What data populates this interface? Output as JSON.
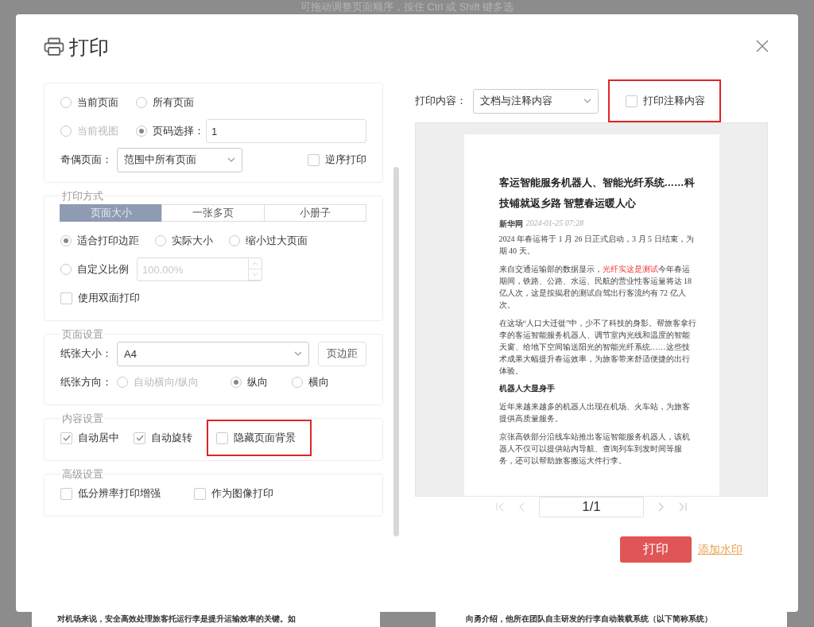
{
  "background_hint": "可拖动调整页面顺序，按住 Ctrl 或 Shift 键多选",
  "dialog": {
    "title": "打印",
    "page_range": {
      "options": [
        {
          "label": "当前页面",
          "selected": false,
          "disabled": false
        },
        {
          "label": "所有页面",
          "selected": false,
          "disabled": false
        },
        {
          "label": "当前视图",
          "selected": false,
          "disabled": true
        },
        {
          "label": "页码选择：",
          "selected": true,
          "disabled": false
        }
      ],
      "page_input": {
        "value": "1"
      },
      "odd_even": {
        "label": "奇偶页面：",
        "value": "范围中所有页面"
      },
      "reverse": {
        "label": "逆序打印",
        "checked": false
      }
    },
    "print_mode": {
      "title": "打印方式",
      "tabs": [
        {
          "label": "页面大小",
          "selected": true
        },
        {
          "label": "一张多页",
          "selected": false
        },
        {
          "label": "小册子",
          "selected": false
        }
      ],
      "scaling": [
        {
          "label": "适合打印边距",
          "selected": true
        },
        {
          "label": "实际大小",
          "selected": false
        },
        {
          "label": "缩小过大页面",
          "selected": false
        },
        {
          "label": "自定义比例",
          "selected": false
        }
      ],
      "scale_input": {
        "value": "100.00%",
        "disabled": true
      },
      "duplex": {
        "label": "使用双面打印",
        "checked": false
      }
    },
    "page_setup": {
      "title": "页面设置",
      "paper_size": {
        "label": "纸张大小：",
        "value": "A4"
      },
      "margins_button": "页边距",
      "orientation": {
        "label": "纸张方向：",
        "options": [
          {
            "label": "自动横向/纵向",
            "selected": false,
            "disabled": true
          },
          {
            "label": "纵向",
            "selected": true,
            "disabled": false
          },
          {
            "label": "横向",
            "selected": false,
            "disabled": false
          }
        ]
      }
    },
    "content_settings": {
      "title": "内容设置",
      "options": [
        {
          "label": "自动居中",
          "checked": true,
          "highlighted": false
        },
        {
          "label": "自动旋转",
          "checked": true,
          "highlighted": false
        },
        {
          "label": "隐藏页面背景",
          "checked": false,
          "highlighted": true
        }
      ]
    },
    "advanced": {
      "title": "高级设置",
      "options": [
        {
          "label": "低分辨率打印增强",
          "checked": false
        },
        {
          "label": "作为图像打印",
          "checked": false
        }
      ]
    },
    "print_content": {
      "label": "打印内容：",
      "value": "文档与注释内容",
      "annotations": {
        "label": "打印注释内容",
        "checked": false,
        "highlighted": true
      }
    },
    "preview": {
      "title": "客运智能服务机器人、智能光纤系统……科技铺就返乡路 智慧春运暖人心",
      "source": "新华网",
      "date": "2024-01-25 07:28",
      "blocks": [
        {
          "kind": "paragraph",
          "parts": [
            {
              "text": "2024 年春运将于 1 月 26 日正式启动，3 月 5 日结束，为期 40 天。",
              "highlight": false
            }
          ]
        },
        {
          "kind": "paragraph",
          "parts": [
            {
              "text": "来自交通运输部的数据显示，",
              "highlight": false
            },
            {
              "text": "光纤实这是测试",
              "highlight": true
            },
            {
              "text": "今年春运期间，铁路、公路、水运、民航的营业性客运量将达 18 亿人次，这是按揭君的测试自驾出行客流约有 72 亿人次。",
              "highlight": false
            }
          ]
        },
        {
          "kind": "paragraph",
          "parts": [
            {
              "text": "在这场“人口大迁徙”中，少不了科技的身影。帮旅客拿行李的客运智能服务机器人、调节室内光线和温度的智能天窗、给地下空间输送阳光的智能光纤系统……这些技术成果大幅提升春运效率，为旅客带来舒适便捷的出行体验。",
              "highlight": false
            }
          ]
        },
        {
          "kind": "heading",
          "text": "机器人大显身手"
        },
        {
          "kind": "paragraph",
          "parts": [
            {
              "text": "近年来越来越多的机器人出现在机场、火车站，为旅客提供高质量服务。",
              "highlight": false
            }
          ]
        },
        {
          "kind": "paragraph",
          "parts": [
            {
              "text": "京张高铁部分沿线车站推出客运智能服务机器人，该机器人不仅可以提供站内导航、查询列车到发时间等服务，还可以帮助旅客搬运大件行李。",
              "highlight": false
            }
          ]
        }
      ]
    },
    "pager": {
      "value": "1/1"
    },
    "print_button": "打印",
    "watermark_link": "添加水印"
  },
  "background_pages": [
    "对机场来说，安全高效处理旅客托运行李是提升运输效率的关键。如",
    "向勇介绍，他所在团队自主研发的行李自动装载系统（以下简称系统）"
  ]
}
